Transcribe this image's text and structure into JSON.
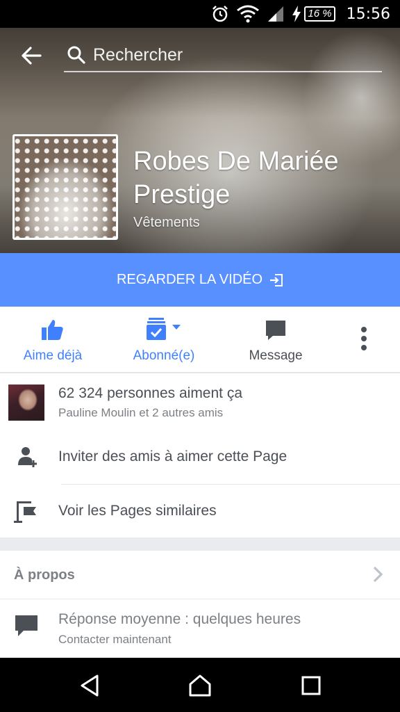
{
  "status_bar": {
    "battery": "16 %",
    "time": "15:56",
    "icons": [
      "alarm-icon",
      "wifi-icon",
      "signal-icon",
      "charging-icon"
    ]
  },
  "header": {
    "search_placeholder": "Rechercher"
  },
  "page": {
    "name": "Robes De Mariée Prestige",
    "category": "Vêtements"
  },
  "cta": {
    "label": "REGARDER LA VIDÉO"
  },
  "actions": {
    "like": "Aime déjà",
    "follow": "Abonné(e)",
    "message": "Message"
  },
  "info": {
    "likes_count": "62 324 personnes aiment ça",
    "likes_friends": "Pauline Moulin et 2 autres amis",
    "invite": "Inviter des amis à aimer cette Page",
    "similar": "Voir les Pages similaires"
  },
  "about": {
    "title": "À propos",
    "response_title": "Réponse moyenne : quelques heures",
    "response_sub": "Contacter maintenant"
  },
  "colors": {
    "brand_blue": "#5890ff",
    "action_blue": "#4080ff",
    "text_dark": "#4b4f56",
    "text_muted": "#7c7f84"
  }
}
